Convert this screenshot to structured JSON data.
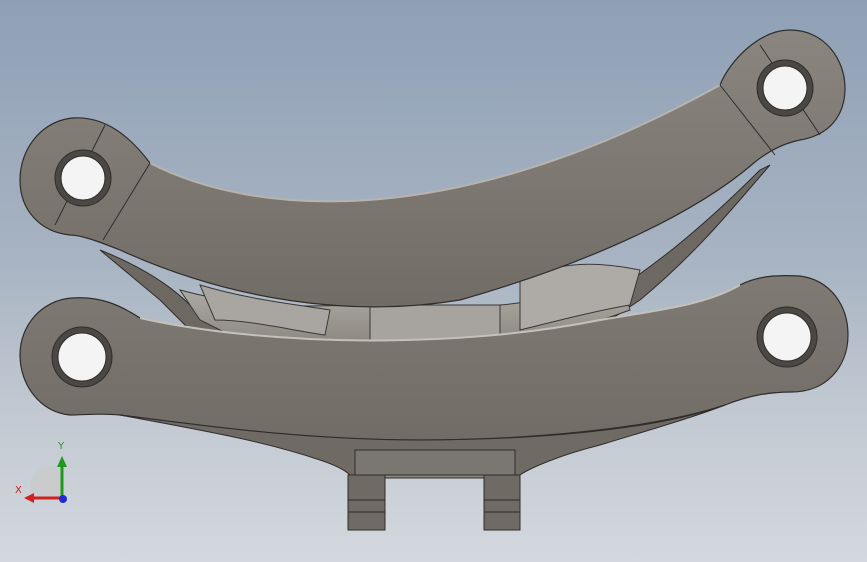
{
  "triad": {
    "x_label": "X",
    "y_label": "Y",
    "x_color": "#d21f1f",
    "y_color": "#1f9a1f",
    "z_color": "#1d2ad8"
  },
  "model": {
    "body_color": "#7c7770",
    "edge_color": "#2f2d2b",
    "shadow_color": "#5e5a55",
    "highlight_color": "#b7b3ad"
  }
}
